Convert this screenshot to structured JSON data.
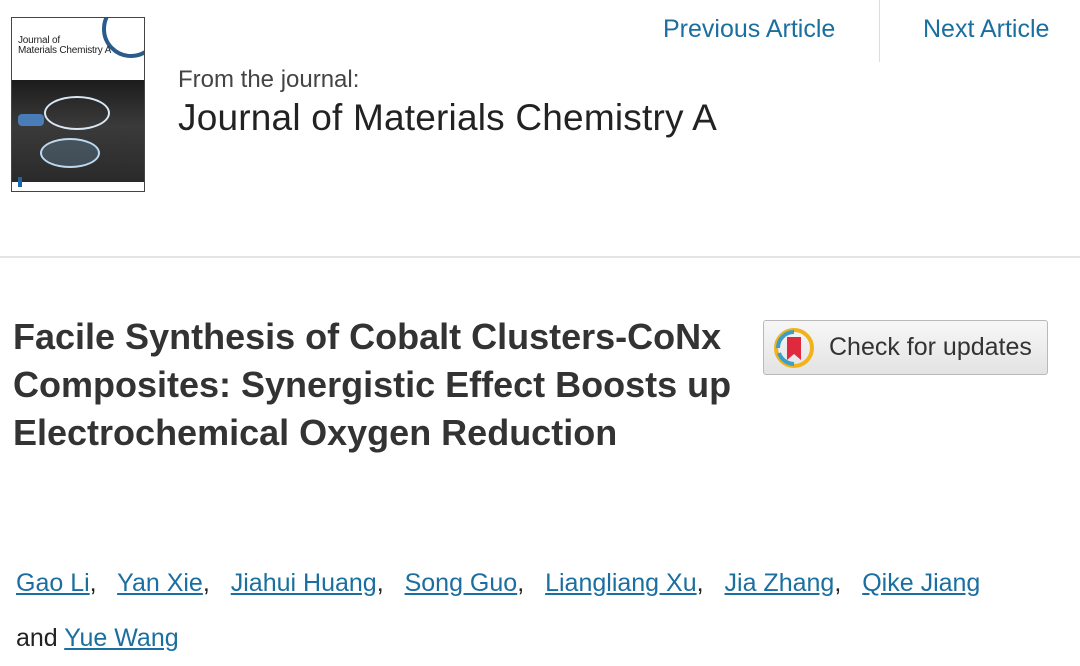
{
  "header": {
    "cover": {
      "title_line1": "Journal of",
      "title_line2": "Materials Chemistry A",
      "alt": "Journal cover"
    },
    "from_label": "From the journal:",
    "journal_name": "Journal of Materials Chemistry A",
    "nav": {
      "previous": "Previous Article",
      "next": "Next Article"
    }
  },
  "article": {
    "title": "Facile Synthesis of Cobalt Clusters-CoNx Composites: Synergistic Effect Boosts up Electrochemical Oxygen Reduction",
    "check_updates": {
      "label": "Check for updates",
      "icon": "bookmark-badge-icon"
    },
    "authors": [
      "Gao Li",
      "Yan Xie",
      "Jiahui Huang",
      "Song Guo",
      "Liangliang Xu",
      "Jia Zhang",
      "Qike Jiang"
    ],
    "and_text": "and",
    "last_author": "Yue Wang",
    "colors": {
      "link": "#1a6fa0",
      "title": "#333333"
    }
  }
}
